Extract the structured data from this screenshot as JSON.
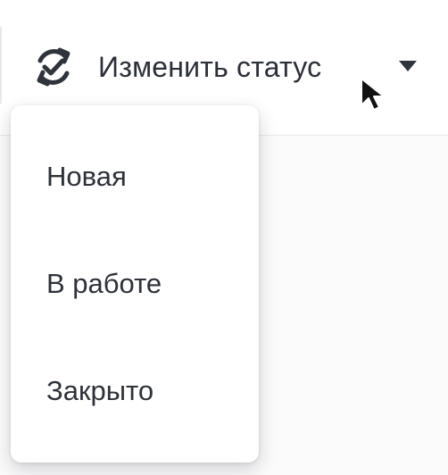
{
  "toolbar": {
    "status_button": {
      "icon": "refresh-check-icon",
      "label": "Изменить статус",
      "dropdown_icon": "caret-down-icon"
    }
  },
  "dropdown": {
    "items": [
      {
        "label": "Новая"
      },
      {
        "label": "В работе"
      },
      {
        "label": "Закрыто"
      }
    ]
  },
  "colors": {
    "page_background": "#fbfbfc",
    "toolbar_background": "#ffffff",
    "text_primary": "#2b2f38",
    "divider": "#e7e8eb",
    "menu_background": "#ffffff"
  },
  "cursor": {
    "icon": "mouse-pointer-icon"
  }
}
